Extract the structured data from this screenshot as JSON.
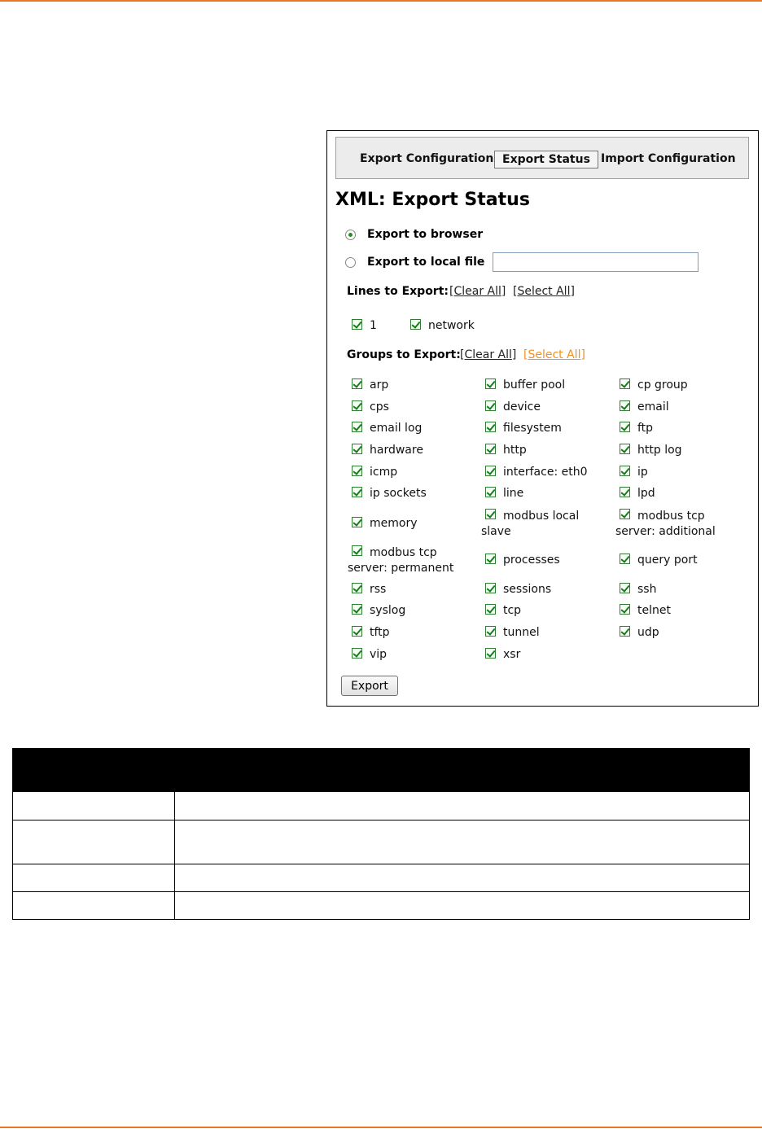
{
  "tabs": [
    {
      "label": "Export Configuration",
      "active": false
    },
    {
      "label": "Export Status",
      "active": true
    },
    {
      "label": "Import Configuration",
      "active": false
    }
  ],
  "page_title": "XML: Export Status",
  "export_options": [
    {
      "label": "Export to browser",
      "selected": true
    },
    {
      "label": "Export to local file",
      "selected": false
    }
  ],
  "local_file_value": "",
  "lines_section": {
    "label": "Lines to Export:",
    "clear_all": "Clear All",
    "select_all": "Select All",
    "items": [
      "1",
      "network"
    ]
  },
  "groups_section": {
    "label": "Groups to Export:",
    "clear_all": "Clear All",
    "select_all": "Select All",
    "select_all_color": "#f29020",
    "items": [
      "arp",
      "buffer pool",
      "cp group",
      "cps",
      "device",
      "email",
      "email log",
      "filesystem",
      "ftp",
      "hardware",
      "http",
      "http log",
      "icmp",
      "interface: eth0",
      "ip",
      "ip sockets",
      "line",
      "lpd",
      "memory",
      "modbus local slave",
      "modbus tcp server: additional",
      "modbus tcp server: permanent",
      "processes",
      "query port",
      "rss",
      "sessions",
      "ssh",
      "syslog",
      "tcp",
      "telnet",
      "tftp",
      "tunnel",
      "udp",
      "vip",
      "xsr"
    ]
  },
  "export_button": "Export",
  "colors": {
    "accent_rule": "#e87722",
    "checkbox_green": "#1b7a1b"
  },
  "table": {
    "header": [
      "",
      ""
    ],
    "rows": [
      [
        "",
        ""
      ],
      [
        "",
        ""
      ],
      [
        "",
        ""
      ],
      [
        "",
        ""
      ]
    ]
  }
}
